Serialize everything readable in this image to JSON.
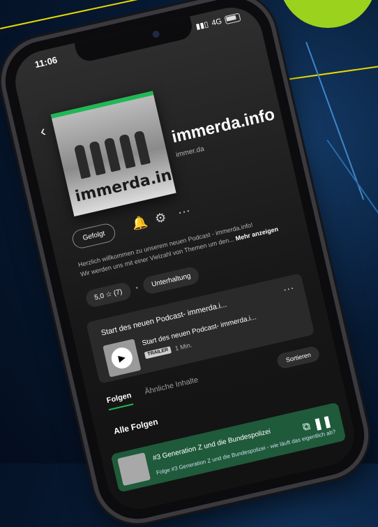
{
  "status": {
    "time": "11:06",
    "network": "4G"
  },
  "podcast": {
    "title": "immerda.info",
    "author": "immer.da",
    "cover_text": "immerda.info",
    "follow_label": "Gefolgt",
    "description": "Herzlich willkommen zu unserem neuen Podcast - immerda.info!",
    "description_line2": "Wir werden uns mit einer Vielzahl von Themen um den...",
    "more_label": "Mehr anzeigen",
    "rating": "5,0 ☆",
    "rating_count": "(7)",
    "category": "Unterhaltung"
  },
  "featured": {
    "title": "Start des neuen Podcast- immerda.i...",
    "badge": "TRAILER",
    "duration": "1 Min."
  },
  "tabs": [
    {
      "label": "Folgen",
      "active": true
    },
    {
      "label": "Ähnliche Inhalte",
      "active": false
    }
  ],
  "sort_label": "Sortieren",
  "section_title": "Alle Folgen",
  "player": {
    "title": "#3 Generation Z und die Bundespolizei",
    "subtitle": "Folge #3 Generation Z und die Bundespolizei - wie läuft das eigentlich ab?"
  },
  "colors": {
    "accent": "#1db954",
    "player_bg": "#1f5a3a"
  },
  "icons": [
    "back-arrow-icon",
    "bell-icon",
    "settings-icon",
    "more-icon",
    "play-icon",
    "devices-icon",
    "pause-icon"
  ]
}
